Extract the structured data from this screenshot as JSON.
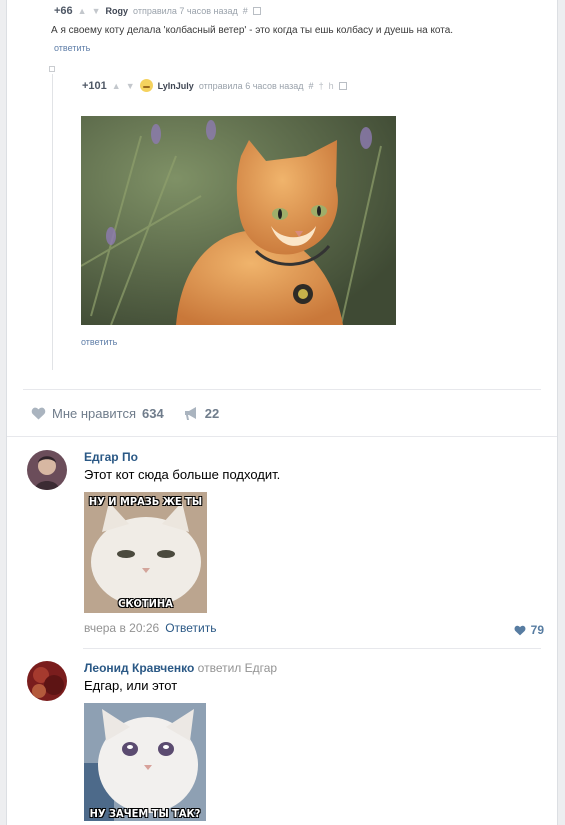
{
  "pikabu": {
    "comment1": {
      "rating": "+66",
      "user": "Rogy",
      "posted": "отправила 7 часов назад",
      "tools": "#",
      "text": "А я своему коту делала 'колбасный ветер' - это когда ты ешь колбасу и дуешь на кота.",
      "reply": "ответить"
    },
    "comment2": {
      "rating": "+101",
      "user": "LyInJuly",
      "posted": "отправила 6 часов назад",
      "tools": "#",
      "reply": "ответить"
    }
  },
  "actions": {
    "like_label": "Мне нравится",
    "like_count": "634",
    "share_count": "22"
  },
  "comments": [
    {
      "author": "Едгар По",
      "text": "Этот кот сюда больше подходит.",
      "meme_top": "НУ И МРАЗЬ ЖЕ ТЫ",
      "meme_bottom": "СКОТИНА",
      "date": "вчера в 20:26",
      "reply": "Ответить",
      "likes": "79"
    },
    {
      "author": "Леонид Кравченко",
      "replied_prefix": "ответил",
      "replied_to": "Едгар",
      "text": "Едгар, или этот",
      "meme_bottom": "НУ ЗАЧЕМ ТЫ ТАК?"
    }
  ],
  "colors": {
    "link": "#2a5885",
    "muted": "#939393",
    "actions": "#6f7c8b"
  }
}
